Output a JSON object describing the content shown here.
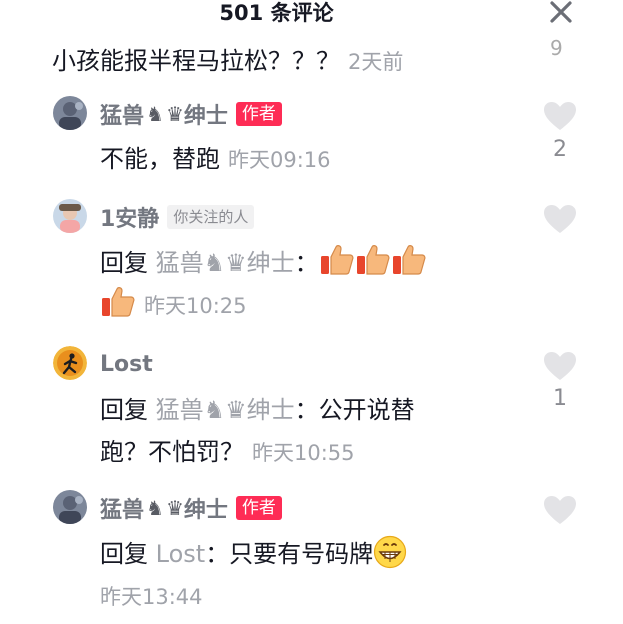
{
  "header": {
    "title": "501 条评论"
  },
  "partial_count": "9",
  "parent": {
    "text": "小孩能报半程马拉松？？？",
    "time": "2天前"
  },
  "colors": {
    "author_badge": "#fe2c55",
    "text": "#161823",
    "gray": "#a0a3aa"
  },
  "comments": [
    {
      "user": "猛兽",
      "badge": "作者",
      "text": "不能，替跑",
      "time": "昨天09:16",
      "likes": "2"
    },
    {
      "user": "1安静",
      "badge": "你关注的人",
      "reply_label": "回复",
      "reply_to": "猛兽",
      "time": "昨天10:25",
      "likes": ""
    },
    {
      "user": "Lost",
      "reply_label": "回复",
      "reply_to": "猛兽",
      "text_a": "：公开说替",
      "text_b": "跑？不怕罚？",
      "time": "昨天10:55",
      "likes": "1"
    },
    {
      "user": "猛兽",
      "badge": "作者",
      "reply_label": "回复",
      "reply_to": "Lost",
      "text": "：只要有号码牌",
      "time": "昨天13:44",
      "likes": ""
    }
  ],
  "glyphs": {
    "knight": "♞",
    "crown": "♛",
    "gentleman": "绅士"
  },
  "icons": [
    "close-icon",
    "heart-icon",
    "thumbs-up-emoji",
    "grinning-emoji"
  ]
}
